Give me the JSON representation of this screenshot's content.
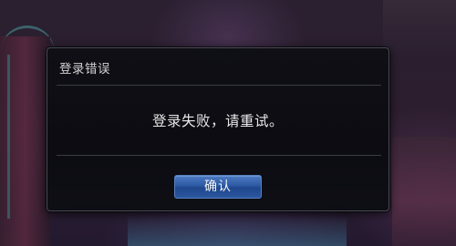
{
  "dialog": {
    "title": "登录错误",
    "message": "登录失败，请重试。",
    "confirm_label": "确认"
  },
  "colors": {
    "dialog_background": "#0c0d12",
    "button_blue": "#2d5ca8",
    "text": "#f0f0f0"
  }
}
